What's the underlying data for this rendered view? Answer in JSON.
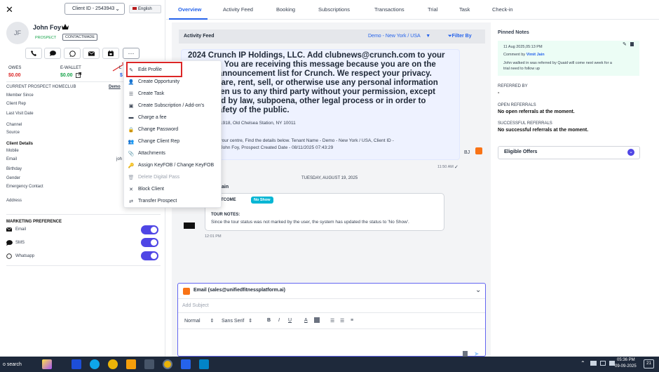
{
  "client": {
    "id_label": "Client ID - 2543943",
    "language": "English",
    "initials": "JF",
    "name": "John Foy",
    "tag_prospect": "PROSPECT",
    "tag_contact": "CONTACTMADE"
  },
  "balances": {
    "owes_label": "OWES",
    "owes_value": "$0.00",
    "ewallet_label": "E-WALLET",
    "ewallet_value": "$0.00",
    "third_label_partial": "L",
    "third_value_partial": "$"
  },
  "profile_rows": {
    "homeclub_label": "CURRENT PROSPECT HOMECLUB",
    "homeclub_value_partial": "Demo",
    "member_since": "Member Since",
    "client_rep": "Client Rep",
    "last_visit": "Last Visit Date",
    "channel": "Channel",
    "source": "Source",
    "client_details": "Client Details",
    "mobile": "Mobile",
    "email": "Email",
    "email_value_partial": "joh",
    "birthday": "Birthday",
    "gender": "Gender",
    "emergency": "Emergency Contact",
    "address": "Address",
    "address_value": "..."
  },
  "marketing": {
    "title": "MARKETING PREFERENCE",
    "items": [
      {
        "label": "Email",
        "on": true
      },
      {
        "label": "SMS",
        "on": true
      },
      {
        "label": "Whatsapp",
        "on": true
      }
    ]
  },
  "menu": {
    "items": [
      {
        "label": "Edit Profile",
        "icon": "pencil-icon"
      },
      {
        "label": "Create Opportunity",
        "icon": "user-plus-icon"
      },
      {
        "label": "Create Task",
        "icon": "list-icon"
      },
      {
        "label": "Create Subscription / Add-on's",
        "icon": "edit-box-icon"
      },
      {
        "label": "Charge a fee",
        "icon": "money-icon"
      },
      {
        "label": "Change Password",
        "icon": "lock-icon"
      },
      {
        "label": "Change Client Rep",
        "icon": "users-icon"
      },
      {
        "label": "Attachments",
        "icon": "paperclip-icon"
      },
      {
        "label": "Assign KeyFOB / Change KeyFOB",
        "icon": "key-icon"
      },
      {
        "label": "Delete Digital Pass",
        "icon": "trash-icon",
        "disabled": true
      },
      {
        "label": "Block Client",
        "icon": "x-icon"
      },
      {
        "label": "Transfer Prospect",
        "icon": "transfer-icon"
      }
    ]
  },
  "tabs": [
    "Overview",
    "Activity Feed",
    "Booking",
    "Subscriptions",
    "Transactions",
    "Trial",
    "Task",
    "Check-in"
  ],
  "feed": {
    "title": "Activity Feed",
    "location": "Demo - New York / USA",
    "filter": "Filter By",
    "message_lines": [
      "2024 Crunch IP Holdings, LLC. Add clubnews@crunch.com to your",
      "book. You are receiving this message because you are on the",
      "onal announcement list for Crunch. We respect your privacy.",
      "ot share, rent, sell, or otherwise use any personal information",
      "e given us to any third party without your permission, except",
      "quired by law, subpoena, other legal process or in order to",
      "he safety of the public."
    ],
    "address_line": "P.O. Box 1918, Old Chelsea Station, NY 10011",
    "detail_line1": "created in your centre, Find the details below. Tenant Name - Demo - New York / USA, Client ID -",
    "detail_line2": "nt Name - John Foy, Prospect Created Date - 08/11/2025 07:43:29",
    "bj": "BJ",
    "time1": "11:50 AM",
    "date_sep": "TUESDAY, AUGUST 19, 2025",
    "author_partial": "ain",
    "outcome_label": "R OUTCOME",
    "outcome_badge": "No Show",
    "tour_notes_label": "TOUR NOTES:",
    "tour_notes_text": "Since the tour status was not marked by the user, the system has updated the status to 'No Show'.",
    "time2": "12:01 PM"
  },
  "composer": {
    "title": "Email (sales@unifiedfitnessplatform.ai)",
    "subject_placeholder": "Add Subject",
    "format": "Normal",
    "font": "Sans Serif",
    "bold": "B",
    "italic": "I",
    "underline": "U",
    "color": "A"
  },
  "right": {
    "pinned_title": "Pinned Notes",
    "note_date": "11 Aug 2025,05:13 PM",
    "note_by_label": "Comment by",
    "note_by": "Vimit Jain",
    "note_text_1": "John walked in was referred by Quaid will come next week for a",
    "note_text_2": "trial need to follow up",
    "referred_by_label": "REFERRED BY",
    "referred_by_value": "-",
    "open_ref_label": "OPEN REFERRALS",
    "open_ref_value": "No open referrals at the moment.",
    "succ_ref_label": "SUCCESSFUL REFERRALS",
    "succ_ref_value": "No successful referrals at the moment.",
    "eligible_offers": "Eligible Offers"
  },
  "taskbar": {
    "search": "o search",
    "time": "05:36 PM",
    "date": "09-09-2025",
    "notif": "21"
  },
  "colors": {
    "accent": "#2563eb",
    "danger": "#dc2626",
    "success": "#16a34a",
    "toggle": "#4f46e5",
    "badge": "#06b6d4"
  }
}
